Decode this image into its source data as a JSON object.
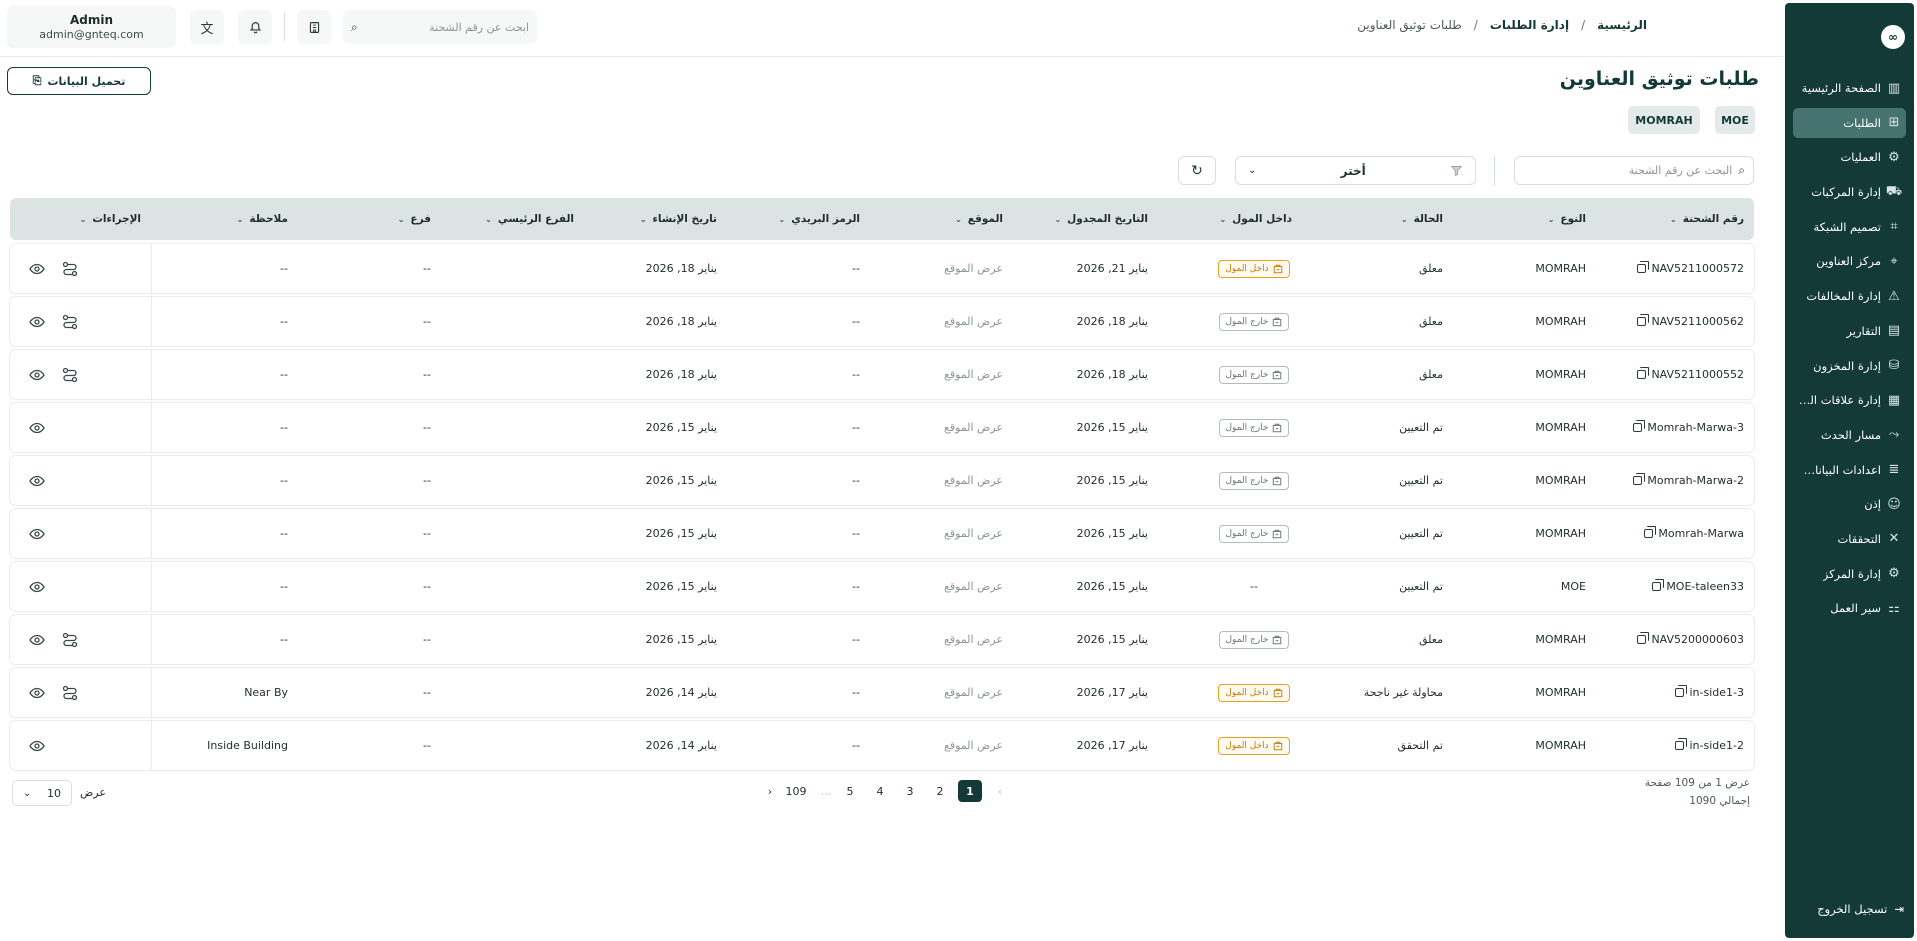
{
  "sidebar": {
    "logo_text": "∞",
    "items": [
      {
        "label": "الصفحة الرئيسية",
        "icon": "▥",
        "active": false
      },
      {
        "label": "الطلبات",
        "icon": "⊞",
        "active": true
      },
      {
        "label": "العمليات",
        "icon": "⚙",
        "active": false
      },
      {
        "label": "إدارة المركبات",
        "icon": "⛟",
        "active": false
      },
      {
        "label": "تصميم الشبكة",
        "icon": "⌗",
        "active": false
      },
      {
        "label": "مركز العناوين",
        "icon": "⌖",
        "active": false
      },
      {
        "label": "إدارة المخالفات",
        "icon": "⚠",
        "active": false
      },
      {
        "label": "التقارير",
        "icon": "▤",
        "active": false
      },
      {
        "label": "إدارة المخزون",
        "icon": "⛁",
        "active": false
      },
      {
        "label": "إدارة علاقات العملاء",
        "icon": "▦",
        "active": false
      },
      {
        "label": "مسار الحدث",
        "icon": "⤳",
        "active": false
      },
      {
        "label": "اعدادات البيانات...",
        "icon": "≣",
        "active": false
      },
      {
        "label": "إذن",
        "icon": "☺",
        "active": false
      },
      {
        "label": "التحققات",
        "icon": "✕",
        "active": false
      },
      {
        "label": "إدارة المركز",
        "icon": "⚙",
        "active": false
      },
      {
        "label": "سير العمل",
        "icon": "⚏",
        "active": false
      }
    ],
    "logout_label": "تسجيل الخروج"
  },
  "topbar": {
    "user_name": "Admin",
    "user_email": "admin@gnteq.com",
    "search_placeholder": "ابحث عن رقم الشحنة"
  },
  "breadcrumb": {
    "home": "الرئيسية",
    "section": "إدارة الطلبات",
    "current": "طلبات توثيق العناوين",
    "separator": "/"
  },
  "page": {
    "title": "طلبات توثيق العناوين",
    "download_label": "تحميل البيانات",
    "chips": [
      "MOE",
      "MOMRAH"
    ]
  },
  "filters": {
    "search_placeholder": "البحث عن رقم الشحنة",
    "select_label": "أختر"
  },
  "table": {
    "columns": {
      "shipment": "رقم الشحنة",
      "type": "النوع",
      "status": "الحالة",
      "inside_mall": "داخل المول",
      "scheduled_date": "التاريخ المجدول",
      "location": "الموقع",
      "postal": "الرمز البريدي",
      "created": "تاريخ الإنشاء",
      "main_branch": "الفرع الرئيسي",
      "branch": "فرع",
      "note": "ملاحظة",
      "actions": "الإجراءات"
    },
    "rows": [
      {
        "shipment": "NAV5211000572",
        "type": "MOMRAH",
        "status": "معلق",
        "mall": "داخل المول",
        "mall_kind": "in",
        "scheduled": "يناير 21, 2026",
        "location": "عرض الموقع",
        "postal": "--",
        "created": "يناير 18, 2026",
        "main_branch": "",
        "branch": "--",
        "note": "--",
        "has_route": true
      },
      {
        "shipment": "NAV5211000562",
        "type": "MOMRAH",
        "status": "معلق",
        "mall": "خارج المول",
        "mall_kind": "out",
        "scheduled": "يناير 18, 2026",
        "location": "عرض الموقع",
        "postal": "--",
        "created": "يناير 18, 2026",
        "main_branch": "",
        "branch": "--",
        "note": "--",
        "has_route": true
      },
      {
        "shipment": "NAV5211000552",
        "type": "MOMRAH",
        "status": "معلق",
        "mall": "خارج المول",
        "mall_kind": "out",
        "scheduled": "يناير 18, 2026",
        "location": "عرض الموقع",
        "postal": "--",
        "created": "يناير 18, 2026",
        "main_branch": "",
        "branch": "--",
        "note": "--",
        "has_route": true
      },
      {
        "shipment": "Momrah-Marwa-3",
        "type": "MOMRAH",
        "status": "تم التعيين",
        "mall": "خارج المول",
        "mall_kind": "out",
        "scheduled": "يناير 15, 2026",
        "location": "عرض الموقع",
        "postal": "--",
        "created": "يناير 15, 2026",
        "main_branch": "",
        "branch": "--",
        "note": "--",
        "has_route": false
      },
      {
        "shipment": "Momrah-Marwa-2",
        "type": "MOMRAH",
        "status": "تم التعيين",
        "mall": "خارج المول",
        "mall_kind": "out",
        "scheduled": "يناير 15, 2026",
        "location": "عرض الموقع",
        "postal": "--",
        "created": "يناير 15, 2026",
        "main_branch": "",
        "branch": "--",
        "note": "--",
        "has_route": false
      },
      {
        "shipment": "Momrah-Marwa",
        "type": "MOMRAH",
        "status": "تم التعيين",
        "mall": "خارج المول",
        "mall_kind": "out",
        "scheduled": "يناير 15, 2026",
        "location": "عرض الموقع",
        "postal": "--",
        "created": "يناير 15, 2026",
        "main_branch": "",
        "branch": "--",
        "note": "--",
        "has_route": false
      },
      {
        "shipment": "MOE-taleen33",
        "type": "MOE",
        "status": "تم التعيين",
        "mall": "--",
        "mall_kind": "none",
        "scheduled": "يناير 15, 2026",
        "location": "عرض الموقع",
        "postal": "--",
        "created": "يناير 15, 2026",
        "main_branch": "",
        "branch": "--",
        "note": "--",
        "has_route": false
      },
      {
        "shipment": "NAV5200000603",
        "type": "MOMRAH",
        "status": "معلق",
        "mall": "خارج المول",
        "mall_kind": "out",
        "scheduled": "يناير 15, 2026",
        "location": "عرض الموقع",
        "postal": "--",
        "created": "يناير 15, 2026",
        "main_branch": "",
        "branch": "--",
        "note": "--",
        "has_route": true
      },
      {
        "shipment": "in-side1-3",
        "type": "MOMRAH",
        "status": "محاولة غير ناجحة",
        "mall": "داخل المول",
        "mall_kind": "in",
        "scheduled": "يناير 17, 2026",
        "location": "عرض الموقع",
        "postal": "--",
        "created": "يناير 14, 2026",
        "main_branch": "",
        "branch": "--",
        "note": "Near By",
        "has_route": true
      },
      {
        "shipment": "in-side1-2",
        "type": "MOMRAH",
        "status": "تم التحقق",
        "mall": "داخل المول",
        "mall_kind": "in",
        "scheduled": "يناير 17, 2026",
        "location": "عرض الموقع",
        "postal": "--",
        "created": "يناير 14, 2026",
        "main_branch": "",
        "branch": "--",
        "note": "Inside Building",
        "has_route": false
      }
    ]
  },
  "pagination": {
    "info_line": "عرض 1 من 109 صفحة",
    "total_line": "إجمالي 1090",
    "pages": [
      "1",
      "2",
      "3",
      "4",
      "5",
      "...",
      "109"
    ],
    "current": "1",
    "per_page": "10",
    "per_page_label": "عرض"
  },
  "colors": {
    "brand": "#133a37",
    "active_nav": "#46736f",
    "in_mall": "#e5a124",
    "header_bg": "#dce4e3"
  }
}
